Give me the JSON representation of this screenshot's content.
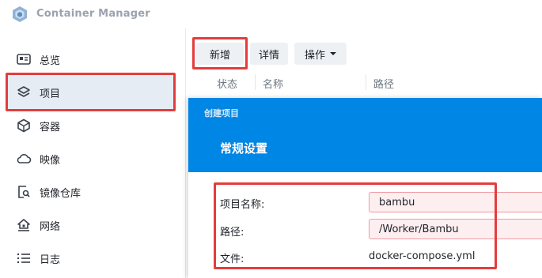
{
  "app": {
    "title": "Container Manager"
  },
  "sidebar": {
    "items": [
      {
        "label": "总览",
        "icon": "overview-card-icon"
      },
      {
        "label": "项目",
        "icon": "layers-icon",
        "active": true
      },
      {
        "label": "容器",
        "icon": "cube-icon"
      },
      {
        "label": "映像",
        "icon": "cloud-icon"
      },
      {
        "label": "镜像仓库",
        "icon": "registry-search-icon"
      },
      {
        "label": "网络",
        "icon": "house-network-icon"
      },
      {
        "label": "日志",
        "icon": "list-icon"
      }
    ]
  },
  "toolbar": {
    "add_label": "新增",
    "details_label": "详情",
    "actions_label": "操作"
  },
  "table": {
    "columns": [
      "状态",
      "名称",
      "路径"
    ]
  },
  "dialog": {
    "crumb": "创建项目",
    "title": "常规设置",
    "fields": {
      "project_name_label": "项目名称:",
      "project_name_value": "bambu",
      "path_label": "路径:",
      "path_value": "/Worker/Bambu",
      "file_label": "文件:",
      "file_value": "docker-compose.yml"
    }
  },
  "colors": {
    "accent": "#0086e5",
    "highlight_border": "#e43c3c",
    "active_bg": "#e6ecf4",
    "input_error_bg": "#fdeef0"
  }
}
